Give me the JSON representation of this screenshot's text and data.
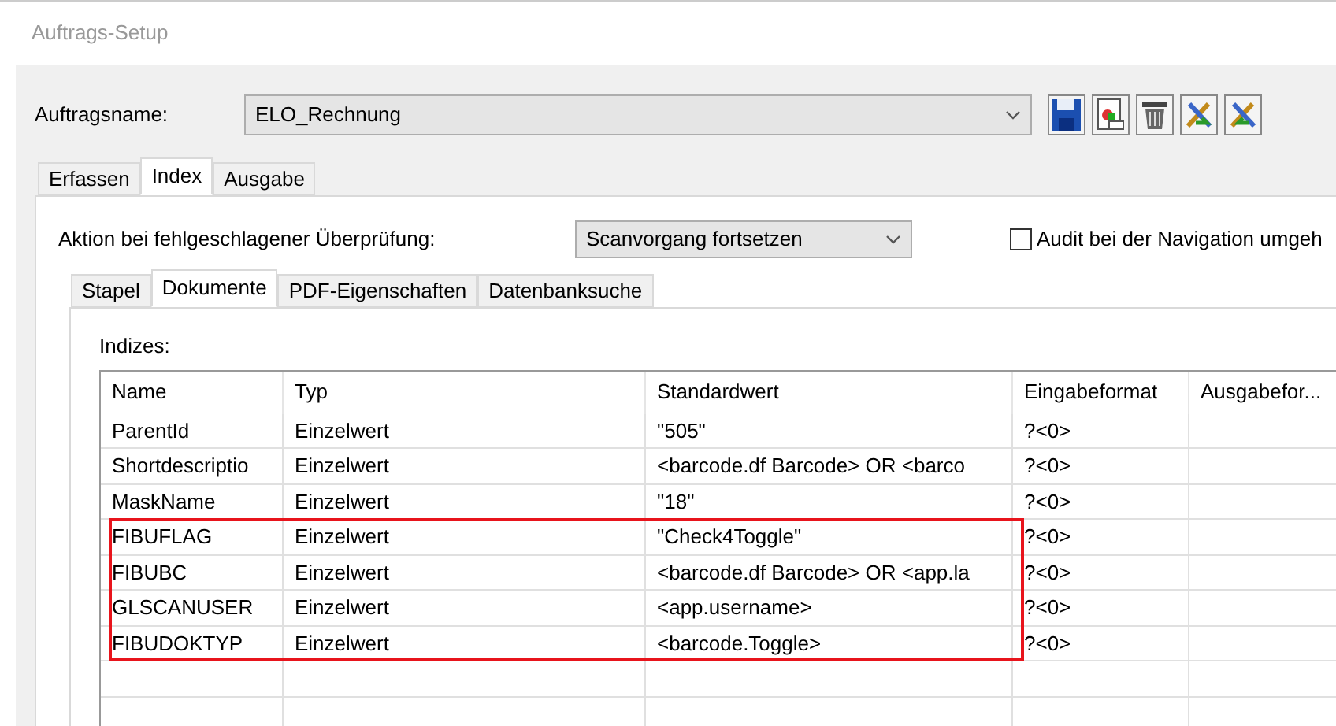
{
  "window": {
    "title": "Auftrags-Setup"
  },
  "job": {
    "label": "Auftragsname:",
    "value": "ELO_Rechnung"
  },
  "tabs": [
    {
      "label": "Erfassen",
      "selected": false
    },
    {
      "label": "Index",
      "selected": true
    },
    {
      "label": "Ausgabe",
      "selected": false
    }
  ],
  "failed_check": {
    "label": "Aktion bei fehlgeschlagener Überprüfung:",
    "value": "Scanvorgang fortsetzen"
  },
  "audit": {
    "label": "Audit bei der Navigation umgeh",
    "checked": false
  },
  "subtabs": [
    {
      "label": "Stapel",
      "selected": false
    },
    {
      "label": "Dokumente",
      "selected": true
    },
    {
      "label": "PDF-Eigenschaften",
      "selected": false
    },
    {
      "label": "Datenbanksuche",
      "selected": false
    }
  ],
  "indices": {
    "label": "Indizes:",
    "columns": [
      "Name",
      "Typ",
      "Standardwert",
      "Eingabeformat",
      "Ausgabefor..."
    ],
    "rows": [
      {
        "cells": [
          "ParentId",
          "Einzelwert",
          "\"505\"",
          "?<0>"
        ],
        "highlighted": false
      },
      {
        "cells": [
          "Shortdescriptio",
          "Einzelwert",
          "<barcode.df Barcode> OR <barco",
          "?<0>"
        ],
        "highlighted": false
      },
      {
        "cells": [
          "MaskName",
          "Einzelwert",
          "\"18\"",
          "?<0>"
        ],
        "highlighted": false
      },
      {
        "cells": [
          "FIBUFLAG",
          "Einzelwert",
          "\"Check4Toggle\"",
          "?<0>"
        ],
        "highlighted": true
      },
      {
        "cells": [
          "FIBUBC",
          "Einzelwert",
          "<barcode.df Barcode> OR <app.la",
          "?<0>"
        ],
        "highlighted": true
      },
      {
        "cells": [
          "GLSCANUSER",
          "Einzelwert",
          "<app.username>",
          "?<0>"
        ],
        "highlighted": true
      },
      {
        "cells": [
          "FIBUDOKTYP",
          "Einzelwert",
          "<barcode.Toggle>",
          "?<0>"
        ],
        "highlighted": true
      }
    ]
  }
}
